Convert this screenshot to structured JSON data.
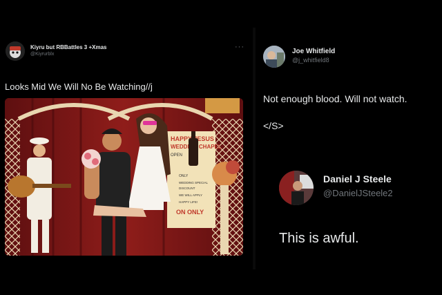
{
  "left_tweet": {
    "display_name": "Kiyru but RBBattles 3 +Xmas",
    "handle": "@Kiyrurblx",
    "more_label": "···",
    "text": "Looks Mid We Will No Be Watching//j",
    "media_sign": {
      "line1": "HAPPY JESUS",
      "line2": "WEDDING CHAPEL",
      "line3": "OPEN",
      "note1": "ONLY",
      "note2": "WEDDING SPECIAL",
      "note3": "DISCOUNT",
      "note4": "WE WILL APPLY",
      "note5": "HAPPY LIFE!",
      "footer": "ON ONLY"
    }
  },
  "right_tweet": {
    "display_name": "Joe Whitfield",
    "handle": "@j_whitfield8",
    "text": "Not enough blood. Will not watch.",
    "tag": "</S>"
  },
  "reply_card": {
    "display_name": "Daniel J Steele",
    "handle": "@DanielJSteele2",
    "text": "This is awful."
  },
  "colors": {
    "background": "#000000",
    "primary_text": "#e7e9ea",
    "secondary_text": "#71767b"
  }
}
